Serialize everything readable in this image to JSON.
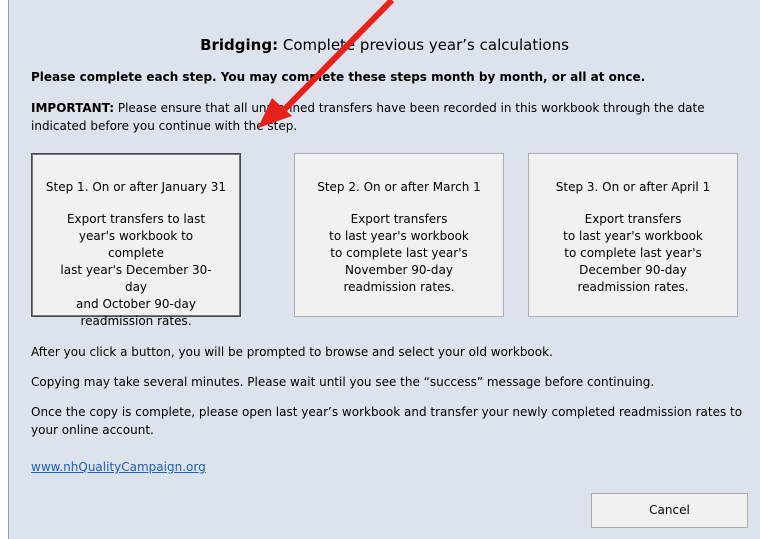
{
  "dialog": {
    "title_bold": "Bridging:",
    "title_rest": " Complete previous year’s calculations",
    "instruction": "Please complete each step. You may complete these steps month by month, or all at once.",
    "important_label": "IMPORTANT:",
    "important_text": "  Please ensure that all unplanned transfers have been recorded in this workbook through the date indicated before you continue with the step."
  },
  "steps": [
    {
      "title": "Step 1. On or after January 31",
      "description": "Export transfers to last\nyear's workbook to complete\nlast year's December 30-day\nand October 90-day\nreadmission rates."
    },
    {
      "title": "Step 2. On or after March 1",
      "description": "Export transfers\nto last year's workbook\nto complete last year's\nNovember 90-day\nreadmission rates."
    },
    {
      "title": "Step 3. On or after April 1",
      "description": "Export transfers\nto last year's workbook\nto complete last year's\nDecember 90-day\nreadmission rates."
    }
  ],
  "notes": {
    "after_click": "After you click a button, you will be prompted to browse and select your old workbook.",
    "copying": "Copying may take several minutes. Please wait until you see the “success” message before continuing.",
    "once_complete": "Once the copy is complete, please open last year’s workbook and transfer your newly completed readmission rates to your online account."
  },
  "link_text": "www.nhQualityCampaign.org",
  "cancel_label": "Cancel",
  "colors": {
    "dialog_bg": "#dde3ec",
    "arrow": "#e8201a",
    "link": "#1f5fb4"
  }
}
